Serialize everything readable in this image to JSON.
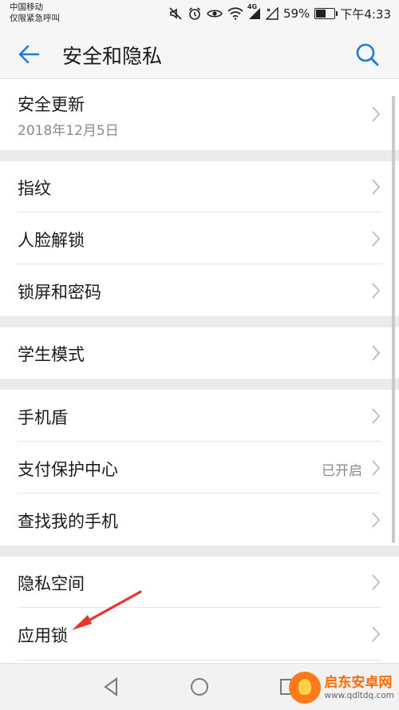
{
  "status_bar": {
    "carrier": "中国移动",
    "emergency": "仅限紧急呼叫",
    "network": "4G",
    "battery_text": "59%",
    "battery_level": 0.59,
    "time": "下午4:33"
  },
  "app_bar": {
    "title": "安全和隐私"
  },
  "items": [
    {
      "title": "安全更新",
      "subtitle": "2018年12月5日",
      "status": ""
    },
    {
      "title": "指纹",
      "subtitle": "",
      "status": ""
    },
    {
      "title": "人脸解锁",
      "subtitle": "",
      "status": ""
    },
    {
      "title": "锁屏和密码",
      "subtitle": "",
      "status": ""
    },
    {
      "title": "学生模式",
      "subtitle": "",
      "status": ""
    },
    {
      "title": "手机盾",
      "subtitle": "",
      "status": ""
    },
    {
      "title": "支付保护中心",
      "subtitle": "",
      "status": "已开启"
    },
    {
      "title": "查找我的手机",
      "subtitle": "",
      "status": ""
    },
    {
      "title": "隐私空间",
      "subtitle": "",
      "status": ""
    },
    {
      "title": "应用锁",
      "subtitle": "",
      "status": ""
    }
  ],
  "watermark": {
    "name": "启东安卓网",
    "url": "www.qdltdq.com"
  },
  "colors": {
    "accent": "#1a7cd6",
    "arrow": "#e6352b",
    "status_text": "#8a8a8a"
  },
  "icons": {
    "back": "arrow-left",
    "search": "magnifier",
    "chevron": "chevron-right"
  }
}
